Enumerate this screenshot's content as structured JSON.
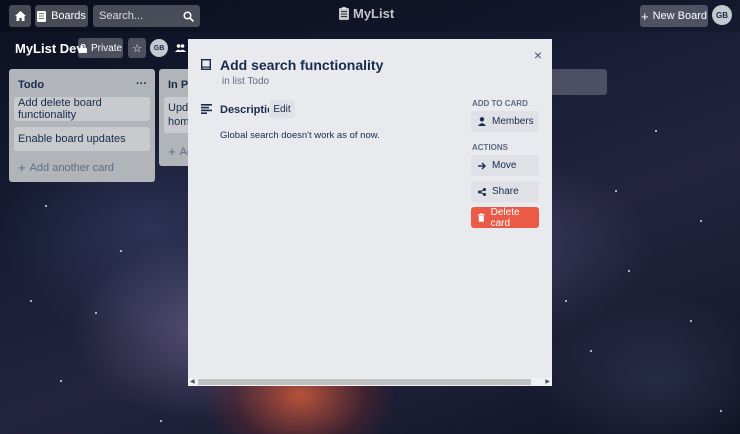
{
  "app": {
    "name": "MyList"
  },
  "topbar": {
    "boards_label": "Boards",
    "search_placeholder": "Search...",
    "new_board_label": "New Board",
    "user_initials": "GB"
  },
  "board": {
    "title": "MyList Dev",
    "visibility_label": "Private",
    "member_initials": "GB"
  },
  "lists": [
    {
      "title": "Todo",
      "cards": [
        "Add delete board functionality",
        "Enable board updates"
      ],
      "add_card_label": "Add another card"
    },
    {
      "title": "In Pro",
      "cards": [
        "Updat",
        "homep"
      ],
      "add_card_label": "Ad"
    }
  ],
  "modal": {
    "title": "Add search functionality",
    "list_ref": "in list Todo",
    "description_label": "Description",
    "edit_label": "Edit",
    "description_text": "Global search doesn't work as of now.",
    "add_to_card_heading": "ADD TO CARD",
    "members_label": "Members",
    "actions_heading": "ACTIONS",
    "move_label": "Move",
    "share_label": "Share",
    "delete_label": "Delete card",
    "close_symbol": "×"
  },
  "colors": {
    "danger": "#eb5a46",
    "list_bg": "#b1b4b8",
    "modal_bg": "#e8eaed"
  }
}
